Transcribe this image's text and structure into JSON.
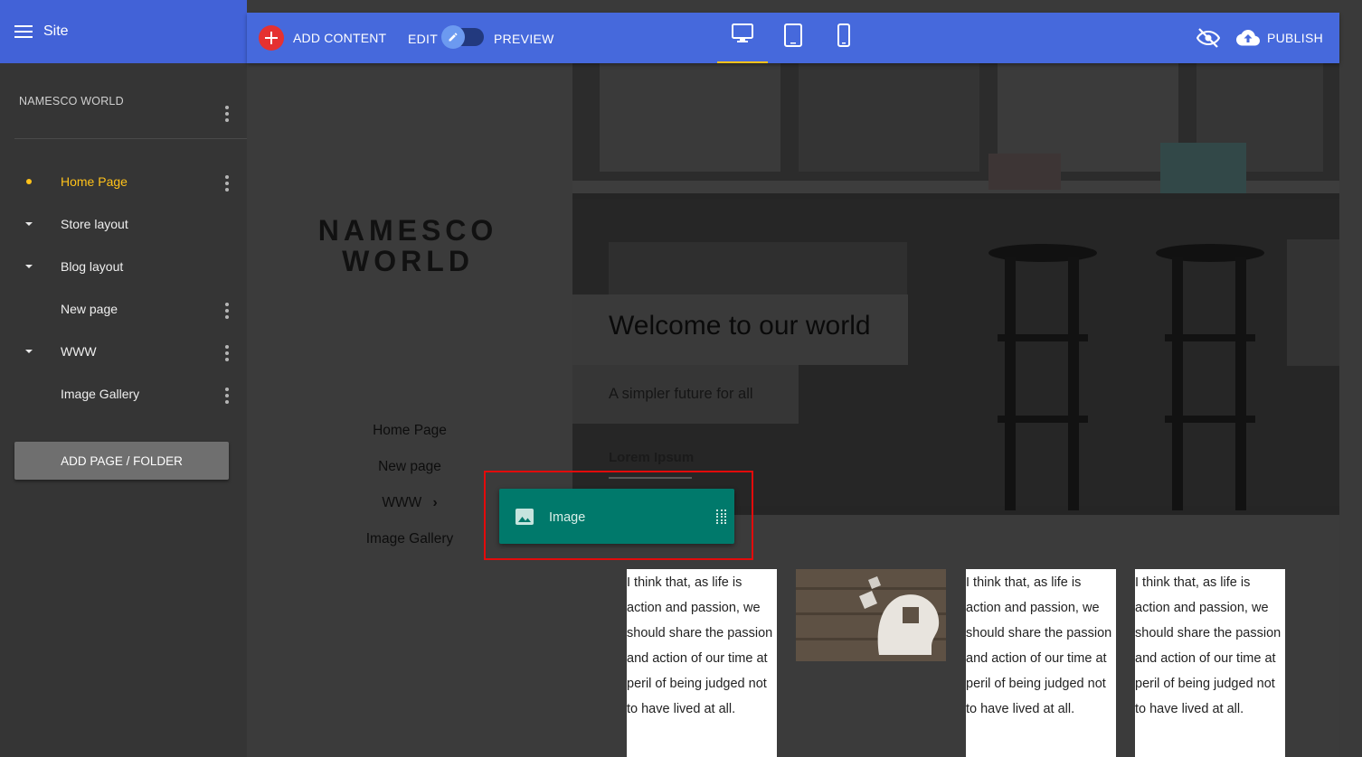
{
  "app": {
    "site_label": "Site"
  },
  "sidebar": {
    "site_name": "NAMESCO WORLD",
    "items": [
      {
        "label": "Home Page",
        "marker": "dot",
        "active": true,
        "kebab": true
      },
      {
        "label": "Store layout",
        "marker": "caret",
        "active": false,
        "kebab": false
      },
      {
        "label": "Blog layout",
        "marker": "caret",
        "active": false,
        "kebab": false
      },
      {
        "label": "New page",
        "marker": "none",
        "active": false,
        "kebab": true
      },
      {
        "label": "WWW",
        "marker": "caret",
        "active": false,
        "kebab": true
      },
      {
        "label": "Image Gallery",
        "marker": "none",
        "active": false,
        "kebab": true
      }
    ],
    "add_page_label": "ADD PAGE / FOLDER"
  },
  "toolbar": {
    "add_content_label": "ADD CONTENT",
    "edit_label": "EDIT",
    "preview_label": "PREVIEW",
    "devices": [
      "desktop-icon",
      "tablet-icon",
      "phone-icon"
    ],
    "active_device": "desktop",
    "publish_label": "PUBLISH"
  },
  "preview": {
    "logo_line1": "NAMESCO",
    "logo_line2": "WORLD",
    "nav": [
      "Home Page",
      "New page",
      "WWW",
      "Image Gallery"
    ],
    "hero_title": "Welcome to our world",
    "hero_subtitle": "A simpler future for all",
    "hero_link": "Lorem Ipsum",
    "column_text": "I think that, as life is action and passion, we should share the passion and action of our time at peril of being judged not to have lived at all."
  },
  "drag": {
    "label": "Image",
    "icon": "image-icon"
  },
  "colors": {
    "header_blue": "#4262d7",
    "toolbar_blue": "#4669dc",
    "accent_yellow": "#ffc21a",
    "add_red": "#e53131",
    "chip_teal": "#00796b",
    "highlight_red": "#e20b0b"
  }
}
